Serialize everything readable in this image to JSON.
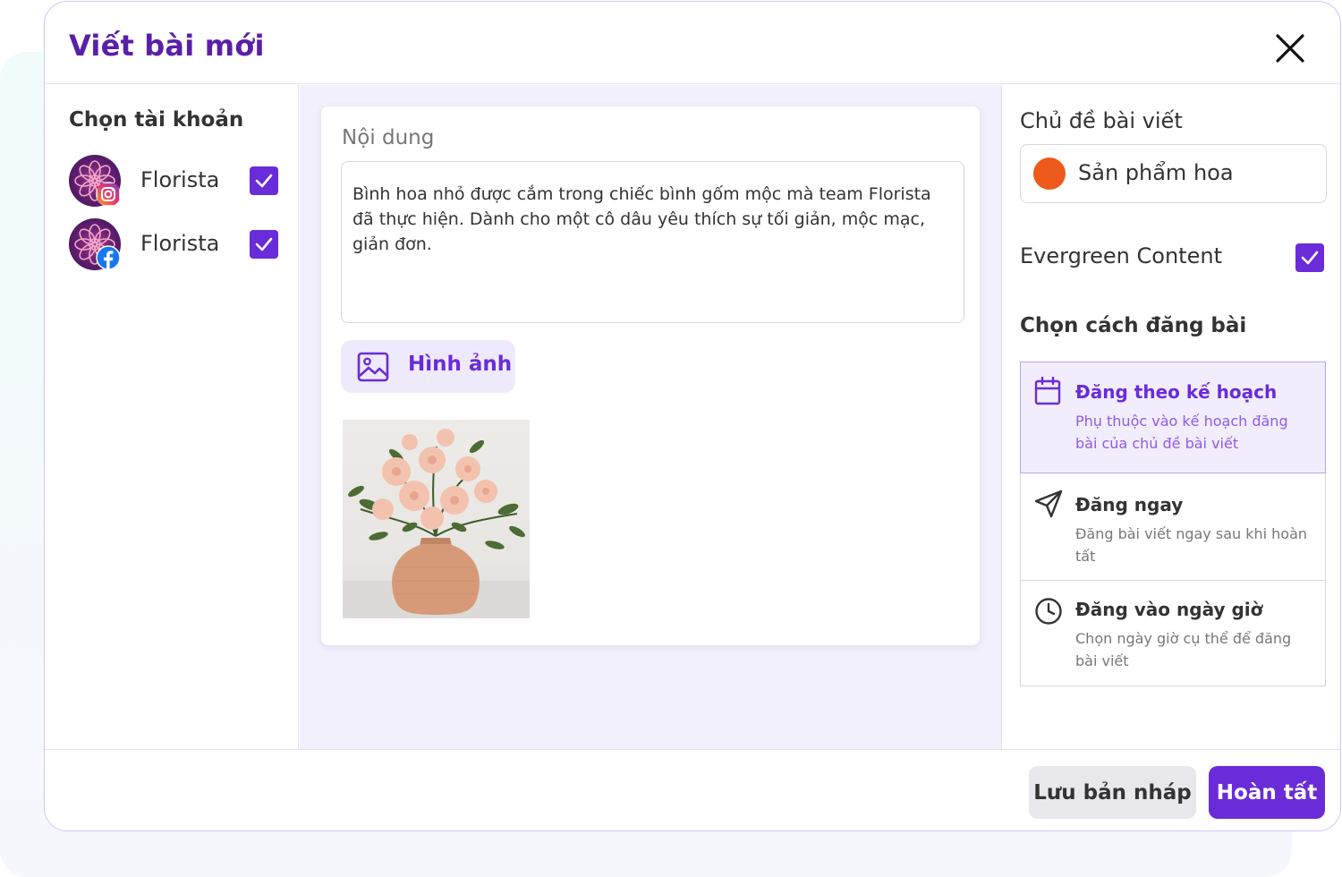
{
  "modal": {
    "title": "Viết bài mới"
  },
  "accounts": {
    "heading": "Chọn tài khoản",
    "items": [
      {
        "name": "Florista",
        "platform": "instagram",
        "checked": true
      },
      {
        "name": "Florista",
        "platform": "facebook",
        "checked": true
      }
    ]
  },
  "content": {
    "label": "Nội dung",
    "text": "Bình hoa nhỏ được cắm trong chiếc bình gốm mộc mà team Florista đã thực hiện. Dành cho một cô dâu yêu thích sự tối giản, mộc mạc, giản đơn.",
    "image_button": "Hình ảnh"
  },
  "settings": {
    "topic_heading": "Chủ đề bài viết",
    "topic_value": "Sản phẩm hoa",
    "topic_color": "#ED5A1B",
    "evergreen_label": "Evergreen Content",
    "evergreen_checked": true,
    "publish_heading": "Chọn cách đăng bài",
    "options": [
      {
        "title": "Đăng theo kế hoạch",
        "desc": "Phụ thuộc vào kế hoạch đăng bài của chủ đề bài viết",
        "icon": "calendar-icon",
        "selected": true
      },
      {
        "title": "Đăng ngay",
        "desc": "Đăng bài viết ngay sau khi hoàn tất",
        "icon": "send-icon",
        "selected": false
      },
      {
        "title": "Đăng vào ngày giờ",
        "desc": "Chọn ngày giờ cụ thể để đăng bài viết",
        "icon": "clock-icon",
        "selected": false
      }
    ]
  },
  "footer": {
    "draft_label": "Lưu bản nháp",
    "done_label": "Hoàn tất"
  },
  "colors": {
    "accent": "#6A2BD9",
    "title": "#5A1FA8",
    "selected_bg": "#F1EDFD"
  }
}
